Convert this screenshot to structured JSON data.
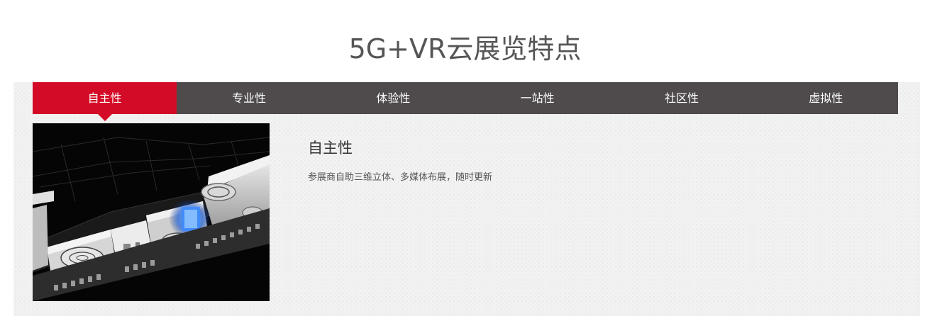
{
  "section": {
    "title": "5G+VR云展览特点"
  },
  "tabs": [
    {
      "label": "自主性",
      "active": true
    },
    {
      "label": "专业性",
      "active": false
    },
    {
      "label": "体验性",
      "active": false
    },
    {
      "label": "一站性",
      "active": false
    },
    {
      "label": "社区性",
      "active": false
    },
    {
      "label": "虚拟性",
      "active": false
    }
  ],
  "feature": {
    "heading": "自主性",
    "description": "参展商自助三维立体、多媒体布展，随时更新",
    "image_icon": "3d-exhibition-hall-render"
  },
  "colors": {
    "accent": "#d40b27",
    "tab_bar": "#4f4b4c",
    "panel_bg": "#f2f2f2",
    "title_text": "#555555"
  }
}
